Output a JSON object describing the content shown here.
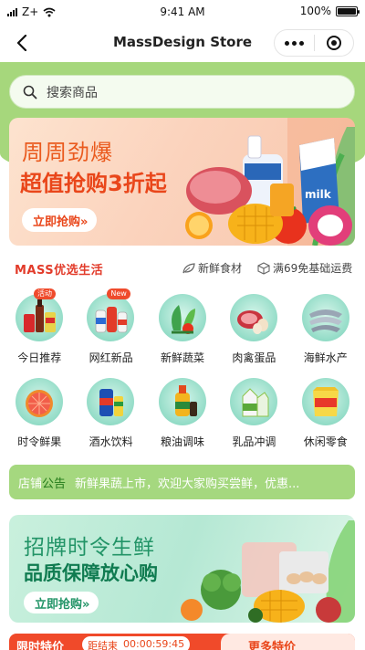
{
  "status_bar": {
    "carrier": "Z+",
    "time": "9:41 AM",
    "battery": "100%",
    "battery_level": 1.0
  },
  "nav": {
    "title": "MassDesign Store"
  },
  "search": {
    "placeholder": "搜索商品"
  },
  "banner1": {
    "line1": "周周劲爆",
    "line2": "超值抢购3折起",
    "button": "立即抢购»"
  },
  "services": {
    "logo": "MASS优选生活",
    "items": [
      {
        "icon": "leaf-icon",
        "label": "新鲜食材"
      },
      {
        "icon": "box-icon",
        "label": "满69免基础运费"
      }
    ]
  },
  "categories": [
    {
      "label": "今日推荐",
      "badge": "活动",
      "icon": "drinks-icon"
    },
    {
      "label": "网红新品",
      "badge": "New",
      "icon": "bottles-icon"
    },
    {
      "label": "新鲜蔬菜",
      "icon": "vegetables-icon"
    },
    {
      "label": "肉禽蛋品",
      "icon": "meat-eggs-icon"
    },
    {
      "label": "海鲜水产",
      "icon": "fish-icon"
    },
    {
      "label": "时令鲜果",
      "icon": "grapefruit-icon"
    },
    {
      "label": "酒水饮料",
      "icon": "soda-can-icon"
    },
    {
      "label": "粮油调味",
      "icon": "oil-bottle-icon"
    },
    {
      "label": "乳品冲调",
      "icon": "milk-carton-icon"
    },
    {
      "label": "休闲零食",
      "icon": "snack-bag-icon"
    }
  ],
  "notice": {
    "shop": "店铺",
    "tag": "公告",
    "text": "新鲜果蔬上市，欢迎大家购买尝鲜，优惠..."
  },
  "banner2": {
    "line1": "招牌时令生鲜",
    "line2": "品质保障放心购",
    "button": "立即抢购»"
  },
  "bottom_strip": {
    "left_title": "限时特价",
    "timer_label": "距结束",
    "timer_value": "00:00:59:45",
    "right_title": "更多特价"
  },
  "colors": {
    "brand_green": "#a6d77c",
    "accent_orange": "#e9461a",
    "teal": "#229467"
  }
}
